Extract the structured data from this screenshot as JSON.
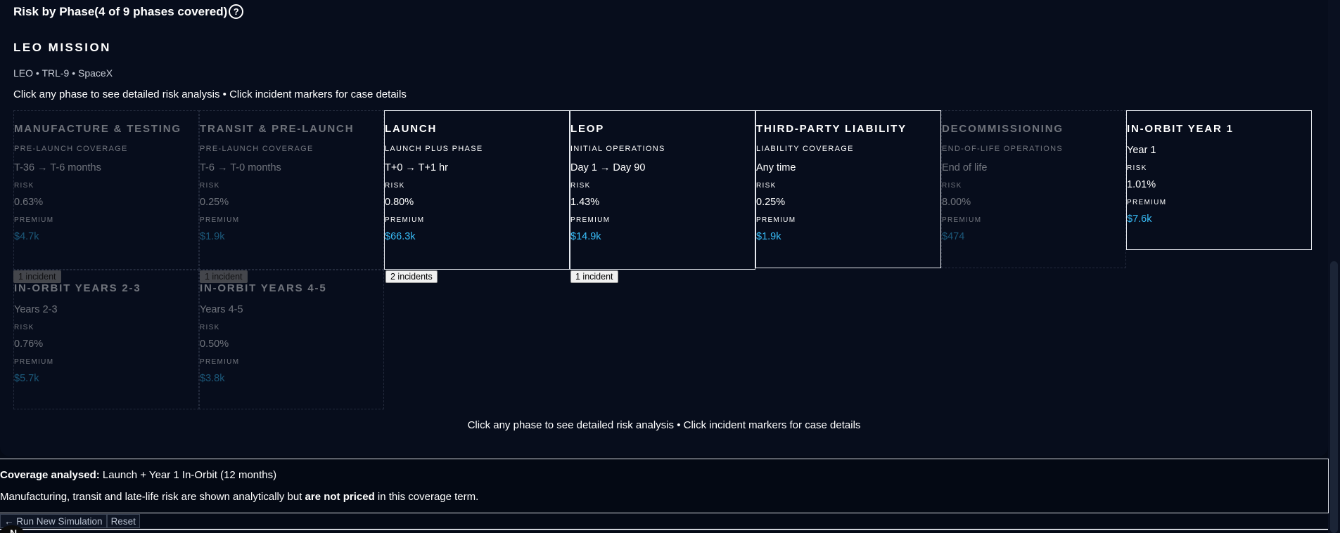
{
  "header": {
    "title": "Risk by Phase(4 of 9 phases covered)",
    "help_icon": "?"
  },
  "mission": {
    "title": "LEO MISSION",
    "subtitle": "LEO • TRL-9 • SpaceX"
  },
  "instructions": "Click any phase to see detailed risk analysis • Click incident markers for case details",
  "labels": {
    "risk": "RISK",
    "premium": "PREMIUM"
  },
  "phases": [
    {
      "name": "MANUFACTURE & TESTING",
      "sub": "PRE-LAUNCH COVERAGE",
      "period": "T-36 → T-6 months",
      "risk": "0.63%",
      "premium": "$4.7k",
      "covered": false,
      "incidents": "1 incident"
    },
    {
      "name": "TRANSIT & PRE-LAUNCH",
      "sub": "PRE-LAUNCH COVERAGE",
      "period": "T-6 → T-0 months",
      "risk": "0.25%",
      "premium": "$1.9k",
      "covered": false,
      "incidents": "1 incident"
    },
    {
      "name": "LAUNCH",
      "sub": "LAUNCH PLUS PHASE",
      "period": "T+0 → T+1 hr",
      "risk": "0.80%",
      "premium": "$66.3k",
      "covered": true,
      "incidents": "2 incidents"
    },
    {
      "name": "LEOP",
      "sub": "INITIAL OPERATIONS",
      "period": "Day 1 → Day 90",
      "risk": "1.43%",
      "premium": "$14.9k",
      "covered": true,
      "incidents": "1 incident"
    },
    {
      "name": "THIRD-PARTY LIABILITY",
      "sub": "LIABILITY COVERAGE",
      "period": "Any time",
      "risk": "0.25%",
      "premium": "$1.9k",
      "covered": true,
      "incidents": ""
    },
    {
      "name": "DECOMMISSIONING",
      "sub": "END-OF-LIFE OPERATIONS",
      "period": "End of life",
      "risk": "8.00%",
      "premium": "$474",
      "covered": false,
      "incidents": ""
    },
    {
      "name": "IN-ORBIT YEAR 1",
      "sub": "",
      "period": "Year 1",
      "risk": "1.01%",
      "premium": "$7.6k",
      "covered": true,
      "incidents": ""
    },
    {
      "name": "IN-ORBIT YEARS 2-3",
      "sub": "",
      "period": "Years 2-3",
      "risk": "0.76%",
      "premium": "$5.7k",
      "covered": false,
      "incidents": ""
    },
    {
      "name": "IN-ORBIT YEARS 4-5",
      "sub": "",
      "period": "Years 4-5",
      "risk": "0.50%",
      "premium": "$3.8k",
      "covered": false,
      "incidents": ""
    }
  ],
  "coverage": {
    "label": "Coverage analysed:",
    "value": " Launch + Year 1 In-Orbit (12 months)",
    "note_prefix": "Manufacturing, transit and late-life risk are shown analytically but ",
    "note_bold": "are not priced",
    "note_suffix": " in this coverage term."
  },
  "buttons": {
    "run_new": "← Run New Simulation",
    "reset": "Reset"
  },
  "avatar_initial": "N"
}
